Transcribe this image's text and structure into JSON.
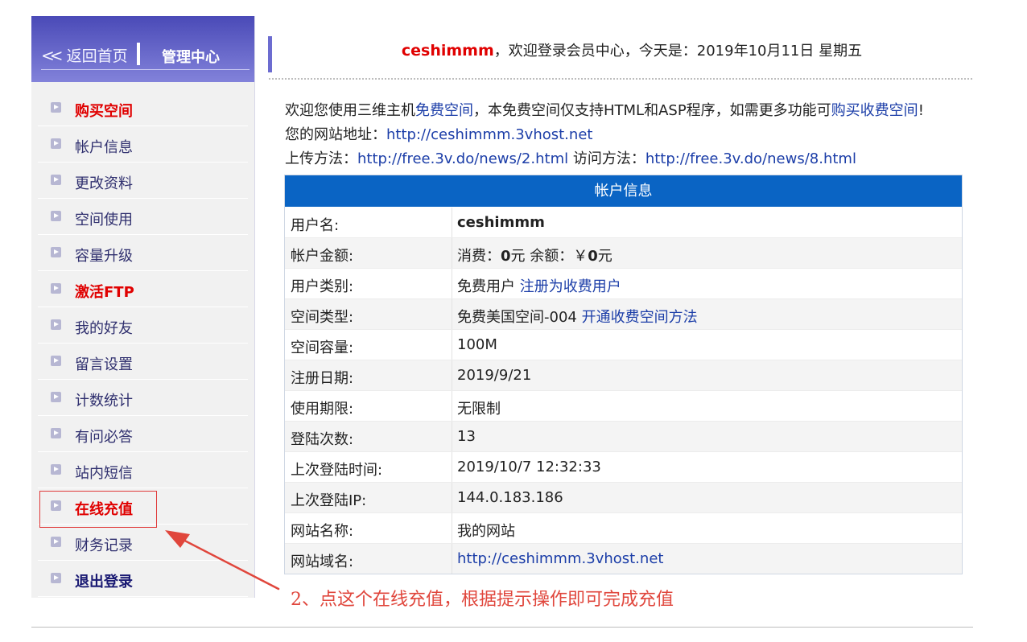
{
  "sidebar": {
    "back_home": "返回首页",
    "management_center": "管理中心",
    "items": [
      {
        "label": "购买空间",
        "style": "red"
      },
      {
        "label": "帐户信息",
        "style": "normal"
      },
      {
        "label": "更改资料",
        "style": "normal"
      },
      {
        "label": "空间使用",
        "style": "normal"
      },
      {
        "label": "容量升级",
        "style": "normal"
      },
      {
        "label": "激活FTP",
        "style": "red"
      },
      {
        "label": "我的好友",
        "style": "normal"
      },
      {
        "label": "留言设置",
        "style": "normal"
      },
      {
        "label": "计数统计",
        "style": "normal"
      },
      {
        "label": "有问必答",
        "style": "normal"
      },
      {
        "label": "站内短信",
        "style": "normal"
      },
      {
        "label": "在线充值",
        "style": "red"
      },
      {
        "label": "财务记录",
        "style": "normal"
      },
      {
        "label": "退出登录",
        "style": "navy"
      }
    ]
  },
  "header": {
    "username": "ceshimmm",
    "welcome_text": "，欢迎登录会员中心，今天是：2019年10月11日 星期五"
  },
  "intro": {
    "line1_prefix": "欢迎您使用三维主机",
    "line1_link1": "免费空间",
    "line1_mid": "，本免费空间仅支持HTML和ASP程序，如需更多功能可",
    "line1_link2": "购买收费空间",
    "line1_suffix": "!",
    "line2_label": "您的网站地址：",
    "line2_link": "http://ceshimmm.3vhost.net",
    "line3_label1": "上传方法：",
    "line3_link1": "http://free.3v.do/news/2.html",
    "line3_label2": " 访问方法：",
    "line3_link2": "http://free.3v.do/news/8.html"
  },
  "account": {
    "title": "帐户信息",
    "rows": [
      {
        "key": "用户名:",
        "value": "ceshimmm"
      },
      {
        "key": "帐户金额:",
        "v1": "消费：",
        "v2": "0",
        "v3": "元 余额：￥",
        "v4": "0",
        "v5": "元"
      },
      {
        "key": "用户类别:",
        "value": "免费用户 ",
        "link": "注册为收费用户"
      },
      {
        "key": "空间类型:",
        "value": "免费美国空间-004 ",
        "link": "开通收费空间方法"
      },
      {
        "key": "空间容量:",
        "value": "100M"
      },
      {
        "key": "注册日期:",
        "value": "2019/9/21"
      },
      {
        "key": "使用期限:",
        "value": "无限制"
      },
      {
        "key": "登陆次数:",
        "value": "13"
      },
      {
        "key": "上次登陆时间:",
        "value": "2019/10/7 12:32:33"
      },
      {
        "key": "上次登陆IP:",
        "value": "144.0.183.186"
      },
      {
        "key": "网站名称:",
        "value": "我的网站"
      },
      {
        "key": "网站域名:",
        "link": "http://ceshimmm.3vhost.net"
      }
    ]
  },
  "annotation": {
    "text": "2、点这个在线充值，根据提示操作即可完成充值",
    "color": "#e0463c"
  },
  "colors": {
    "accent_blue": "#0a64c4",
    "sidebar_header": "#4a4ab7",
    "highlight_red": "#e00000"
  }
}
